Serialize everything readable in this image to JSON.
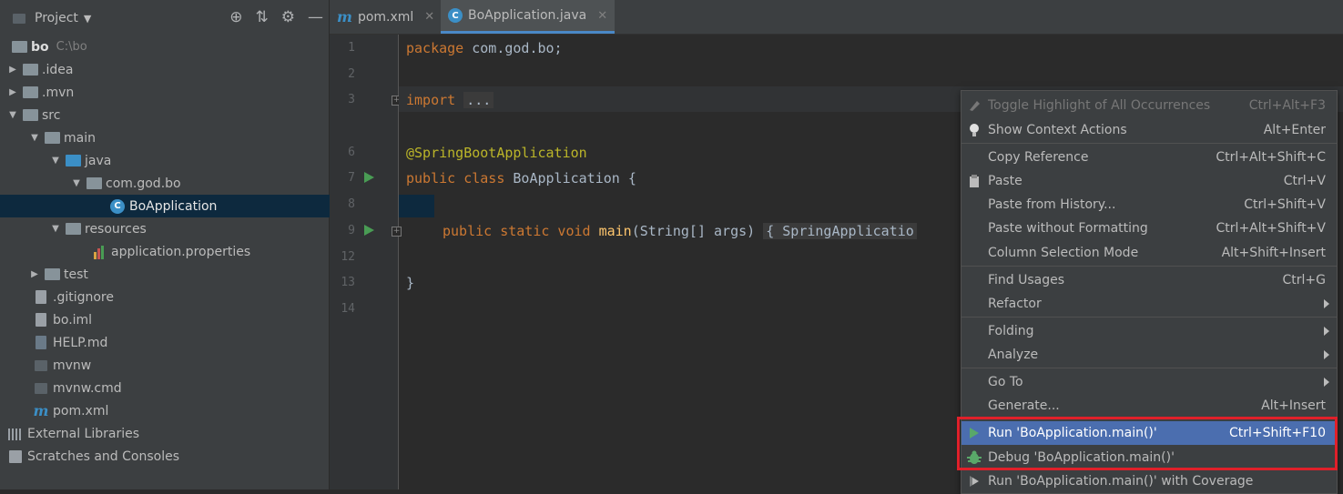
{
  "project_panel": {
    "title": "Project",
    "tree": [
      {
        "label": "bo",
        "hint": "C:\\bo"
      },
      {
        "label": ".idea"
      },
      {
        "label": ".mvn"
      },
      {
        "label": "src"
      },
      {
        "label": "main"
      },
      {
        "label": "java"
      },
      {
        "label": "com.god.bo"
      },
      {
        "label": "BoApplication"
      },
      {
        "label": "resources"
      },
      {
        "label": "application.properties"
      },
      {
        "label": "test"
      },
      {
        "label": ".gitignore"
      },
      {
        "label": "bo.iml"
      },
      {
        "label": "HELP.md"
      },
      {
        "label": "mvnw"
      },
      {
        "label": "mvnw.cmd"
      },
      {
        "label": "pom.xml"
      },
      {
        "label": "External Libraries"
      },
      {
        "label": "Scratches and Consoles"
      }
    ]
  },
  "tabs": [
    {
      "label": "pom.xml"
    },
    {
      "label": "BoApplication.java"
    }
  ],
  "editor": {
    "line_numbers": [
      "1",
      "2",
      "3",
      "6",
      "7",
      "8",
      "9",
      "12",
      "13",
      "14"
    ],
    "code": {
      "l1_kw": "package",
      "l1_rest": " com.god.bo;",
      "l3_kw": "import",
      "l3_fold": "...",
      "l6_ann": "@SpringBootApplication",
      "l7_kw": "public class",
      "l7_rest": " BoApplication {",
      "l9_kw": "public static void",
      "l9_fn": "main",
      "l9_rest": "(String[] args)",
      "l9_fold": "{ SpringApplicatio",
      "l13": "}"
    }
  },
  "context_menu": {
    "items": [
      {
        "label": "Toggle Highlight of All Occurrences",
        "shortcut": "Ctrl+Alt+F3"
      },
      {
        "label": "Show Context Actions",
        "shortcut": "Alt+Enter"
      },
      {
        "label": "Copy Reference",
        "shortcut": "Ctrl+Alt+Shift+C"
      },
      {
        "label": "Paste",
        "shortcut": "Ctrl+V"
      },
      {
        "label": "Paste from History...",
        "shortcut": "Ctrl+Shift+V"
      },
      {
        "label": "Paste without Formatting",
        "shortcut": "Ctrl+Alt+Shift+V"
      },
      {
        "label": "Column Selection Mode",
        "shortcut": "Alt+Shift+Insert"
      },
      {
        "label": "Find Usages",
        "shortcut": "Ctrl+G"
      },
      {
        "label": "Refactor",
        "shortcut": ""
      },
      {
        "label": "Folding",
        "shortcut": ""
      },
      {
        "label": "Analyze",
        "shortcut": ""
      },
      {
        "label": "Go To",
        "shortcut": ""
      },
      {
        "label": "Generate...",
        "shortcut": "Alt+Insert"
      },
      {
        "label": "Run 'BoApplication.main()'",
        "shortcut": "Ctrl+Shift+F10"
      },
      {
        "label": "Debug 'BoApplication.main()'",
        "shortcut": ""
      },
      {
        "label": "Run 'BoApplication.main()' with Coverage",
        "shortcut": ""
      }
    ]
  },
  "colors": {
    "highlight": "#4b6eaf",
    "annotation_box": "#e0202a",
    "run_green": "#499c54"
  }
}
